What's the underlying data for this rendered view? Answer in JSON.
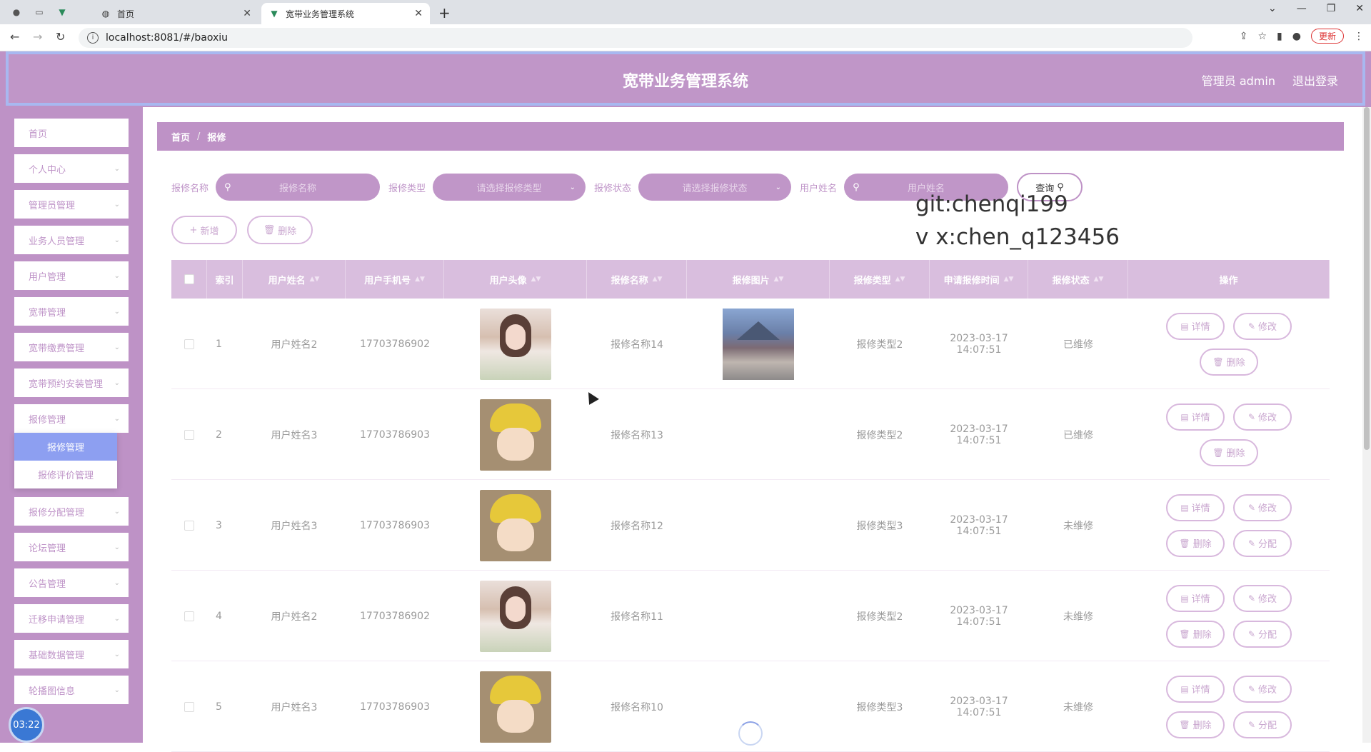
{
  "browser": {
    "tabs": [
      {
        "label": "首页"
      },
      {
        "label": "宽带业务管理系统"
      }
    ],
    "url": "localhost:8081/#/baoxiu",
    "update_label": "更新"
  },
  "header": {
    "title": "宽带业务管理系统",
    "admin_label": "管理员 admin",
    "logout_label": "退出登录"
  },
  "sidebar": {
    "items": [
      {
        "label": "首页"
      },
      {
        "label": "个人中心"
      },
      {
        "label": "管理员管理"
      },
      {
        "label": "业务人员管理"
      },
      {
        "label": "用户管理"
      },
      {
        "label": "宽带管理"
      },
      {
        "label": "宽带缴费管理"
      },
      {
        "label": "宽带预约安装管理"
      },
      {
        "label": "报修管理"
      },
      {
        "label": "报修分配管理"
      },
      {
        "label": "论坛管理"
      },
      {
        "label": "公告管理"
      },
      {
        "label": "迁移申请管理"
      },
      {
        "label": "基础数据管理"
      },
      {
        "label": "轮播图信息"
      }
    ],
    "submenu": [
      {
        "label": "报修管理"
      },
      {
        "label": "报修评价管理"
      }
    ],
    "clock": "03:22"
  },
  "breadcrumb": {
    "home": "首页",
    "current": "报修"
  },
  "search": {
    "name_label": "报修名称",
    "name_placeholder": "报修名称",
    "type_label": "报修类型",
    "type_placeholder": "请选择报修类型",
    "status_label": "报修状态",
    "status_placeholder": "请选择报修状态",
    "user_label": "用户姓名",
    "user_placeholder": "用户姓名",
    "query_label": "查询"
  },
  "actions": {
    "add_label": "新增",
    "delete_label": "删除"
  },
  "watermark": {
    "line1": "git:chenqi199",
    "line2": "v x:chen_q123456"
  },
  "table": {
    "headers": [
      "索引",
      "用户姓名",
      "用户手机号",
      "用户头像",
      "报修名称",
      "报修图片",
      "报修类型",
      "申请报修时间",
      "报修状态",
      "操作"
    ],
    "rows": [
      {
        "index": "1",
        "name": "用户姓名2",
        "phone": "17703786902",
        "avatar": "girl",
        "repair_name": "报修名称14",
        "image": true,
        "type": "报修类型2",
        "time": "2023-03-17 14:07:51",
        "status": "已维修",
        "assign": false
      },
      {
        "index": "2",
        "name": "用户姓名3",
        "phone": "17703786903",
        "avatar": "boy",
        "repair_name": "报修名称13",
        "image": false,
        "type": "报修类型2",
        "time": "2023-03-17 14:07:51",
        "status": "已维修",
        "assign": false
      },
      {
        "index": "3",
        "name": "用户姓名3",
        "phone": "17703786903",
        "avatar": "boy",
        "repair_name": "报修名称12",
        "image": false,
        "type": "报修类型3",
        "time": "2023-03-17 14:07:51",
        "status": "未维修",
        "assign": true
      },
      {
        "index": "4",
        "name": "用户姓名2",
        "phone": "17703786902",
        "avatar": "girl",
        "repair_name": "报修名称11",
        "image": false,
        "type": "报修类型2",
        "time": "2023-03-17 14:07:51",
        "status": "未维修",
        "assign": true
      },
      {
        "index": "5",
        "name": "用户姓名3",
        "phone": "17703786903",
        "avatar": "boy",
        "repair_name": "报修名称10",
        "image": false,
        "type": "报修类型3",
        "time": "2023-03-17 14:07:51",
        "status": "未维修",
        "assign": true
      }
    ],
    "op_labels": {
      "detail": "详情",
      "edit": "修改",
      "delete": "删除",
      "assign": "分配"
    }
  }
}
